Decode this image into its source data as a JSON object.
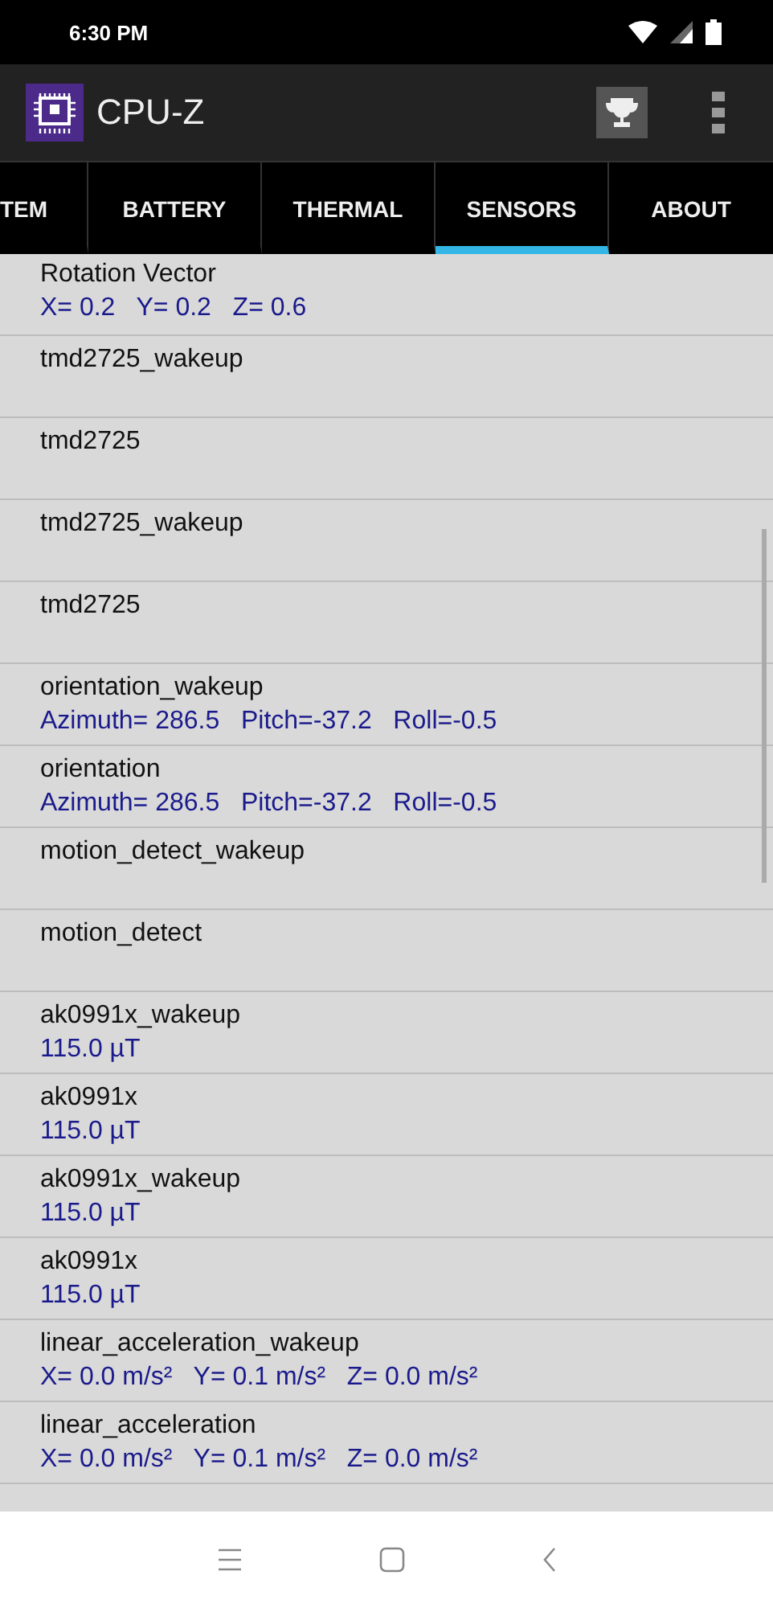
{
  "status_bar": {
    "time": "6:30 PM"
  },
  "app_bar": {
    "title": "CPU-Z"
  },
  "tabs": [
    {
      "label": "TEM",
      "selected": false
    },
    {
      "label": "BATTERY",
      "selected": false
    },
    {
      "label": "THERMAL",
      "selected": false
    },
    {
      "label": "SENSORS",
      "selected": true
    },
    {
      "label": "ABOUT",
      "selected": false
    }
  ],
  "sensors": [
    {
      "name": "Rotation Vector",
      "value": "X= 0.2   Y= 0.2   Z= 0.6"
    },
    {
      "name": "tmd2725_wakeup"
    },
    {
      "name": "tmd2725"
    },
    {
      "name": "tmd2725_wakeup"
    },
    {
      "name": "tmd2725"
    },
    {
      "name": "orientation_wakeup",
      "value": "Azimuth= 286.5   Pitch=-37.2   Roll=-0.5"
    },
    {
      "name": "orientation",
      "value": "Azimuth= 286.5   Pitch=-37.2   Roll=-0.5"
    },
    {
      "name": "motion_detect_wakeup"
    },
    {
      "name": "motion_detect"
    },
    {
      "name": "ak0991x_wakeup",
      "value": "115.0 µT"
    },
    {
      "name": "ak0991x",
      "value": "115.0 µT"
    },
    {
      "name": "ak0991x_wakeup",
      "value": "115.0 µT"
    },
    {
      "name": "ak0991x",
      "value": "115.0 µT"
    },
    {
      "name": "linear_acceleration_wakeup",
      "value": "X= 0.0 m/s²   Y= 0.1 m/s²   Z= 0.0 m/s²"
    },
    {
      "name": "linear_acceleration",
      "value": "X= 0.0 m/s²   Y= 0.1 m/s²   Z= 0.0 m/s²"
    }
  ]
}
